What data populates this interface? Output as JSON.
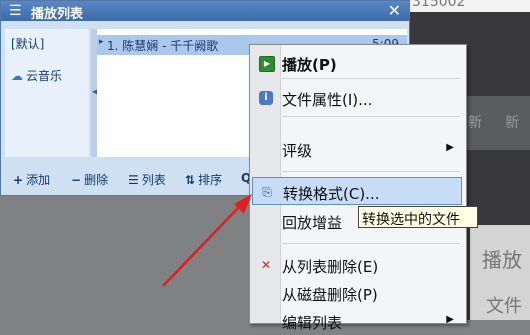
{
  "background": {
    "top_fragment": "315002",
    "side_fragments": [
      "新",
      "新",
      "播放",
      "文件"
    ]
  },
  "window": {
    "title": "播放列表"
  },
  "sidebar": {
    "items": [
      {
        "label": "[默认]"
      },
      {
        "label": "云音乐"
      }
    ]
  },
  "tracklist": {
    "rows": [
      {
        "label": "1. 陈慧娴 - 千千阙歌",
        "time": "5:09"
      }
    ]
  },
  "toolbar": {
    "buttons": [
      {
        "glyph": "+",
        "label": "添加"
      },
      {
        "glyph": "−",
        "label": "删除"
      },
      {
        "glyph": "☰",
        "label": "列表"
      },
      {
        "glyph": "⇅",
        "label": "排序"
      },
      {
        "glyph": "Q",
        "label": ""
      }
    ]
  },
  "context_menu": {
    "items": [
      {
        "label": "播放(P)",
        "icon": "play-icon"
      },
      {
        "label": "文件属性(I)...",
        "icon": "info-icon"
      },
      {
        "label": "评级",
        "submenu": true
      },
      {
        "label": "转换格式(C)...",
        "icon": "convert-icon",
        "highlighted": true
      },
      {
        "label": "回放增益"
      },
      {
        "label": "从列表删除(E)",
        "icon": "delete-icon"
      },
      {
        "label": "从磁盘删除(P)"
      },
      {
        "label": "编辑列表",
        "submenu": true
      }
    ]
  },
  "tooltip": {
    "text": "转换选中的文件"
  },
  "colors": {
    "accent": "#3c6aaa",
    "highlight": "#c7dcf6",
    "annotation_arrow": "#e02020"
  }
}
